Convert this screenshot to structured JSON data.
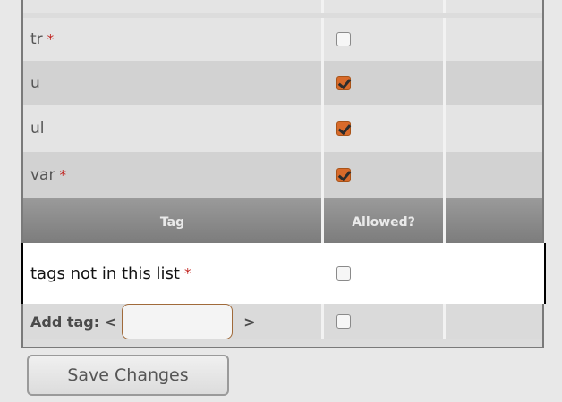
{
  "rows": [
    {
      "tag": "tr",
      "required": "*",
      "allowed": false
    },
    {
      "tag": "u",
      "required": "",
      "allowed": true
    },
    {
      "tag": "ul",
      "required": "",
      "allowed": true
    },
    {
      "tag": "var",
      "required": "*",
      "allowed": true
    }
  ],
  "header": {
    "tag": "Tag",
    "allowed": "Allowed?"
  },
  "not_in_list": {
    "label": "tags not in this list",
    "required": "*",
    "allowed": false
  },
  "add_tag": {
    "label": "Add tag: <",
    "suffix": ">",
    "value": "",
    "allowed": false
  },
  "save_label": "Save Changes",
  "colors": {
    "checked": "#d86a2a",
    "header": "#8a8a8a",
    "required": "#c0201c"
  }
}
